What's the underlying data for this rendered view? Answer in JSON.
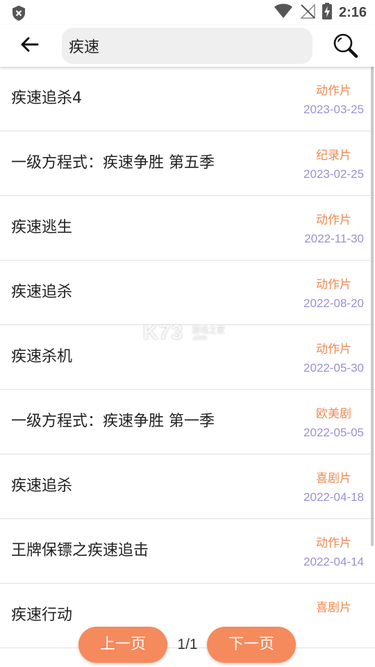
{
  "status_bar": {
    "time": "2:16",
    "icons": [
      "shield-icon",
      "wifi-icon",
      "no-signal-icon",
      "battery-charging-icon"
    ]
  },
  "header": {
    "back_icon": "arrow-left-icon",
    "search_value": "疾速",
    "search_icon": "magnifier-icon"
  },
  "results": [
    {
      "title": "疾速追杀4",
      "category": "动作片",
      "date": "2023-03-25"
    },
    {
      "title": "一级方程式：疾速争胜 第五季",
      "category": "纪录片",
      "date": "2023-02-25"
    },
    {
      "title": "疾速逃生",
      "category": "动作片",
      "date": "2022-11-30"
    },
    {
      "title": "疾速追杀",
      "category": "动作片",
      "date": "2022-08-20"
    },
    {
      "title": "疾速杀机",
      "category": "动作片",
      "date": "2022-05-30"
    },
    {
      "title": "一级方程式：疾速争胜 第一季",
      "category": "欧美剧",
      "date": "2022-05-05"
    },
    {
      "title": "疾速追杀",
      "category": "喜剧片",
      "date": "2022-04-18"
    },
    {
      "title": "王牌保镖之疾速追击",
      "category": "动作片",
      "date": "2022-04-14"
    },
    {
      "title": "疾速行动",
      "category": "喜剧片",
      "date": ""
    }
  ],
  "pagination": {
    "prev_label": "上一页",
    "page_indicator": "1/1",
    "next_label": "下一页"
  },
  "watermark": {
    "logo_text": "K73",
    "tagline": "游戏之家",
    "domain": ".com"
  },
  "colors": {
    "category": "#ef8a53",
    "date": "#9c8fd4",
    "pager_button": "#f58a5c"
  }
}
